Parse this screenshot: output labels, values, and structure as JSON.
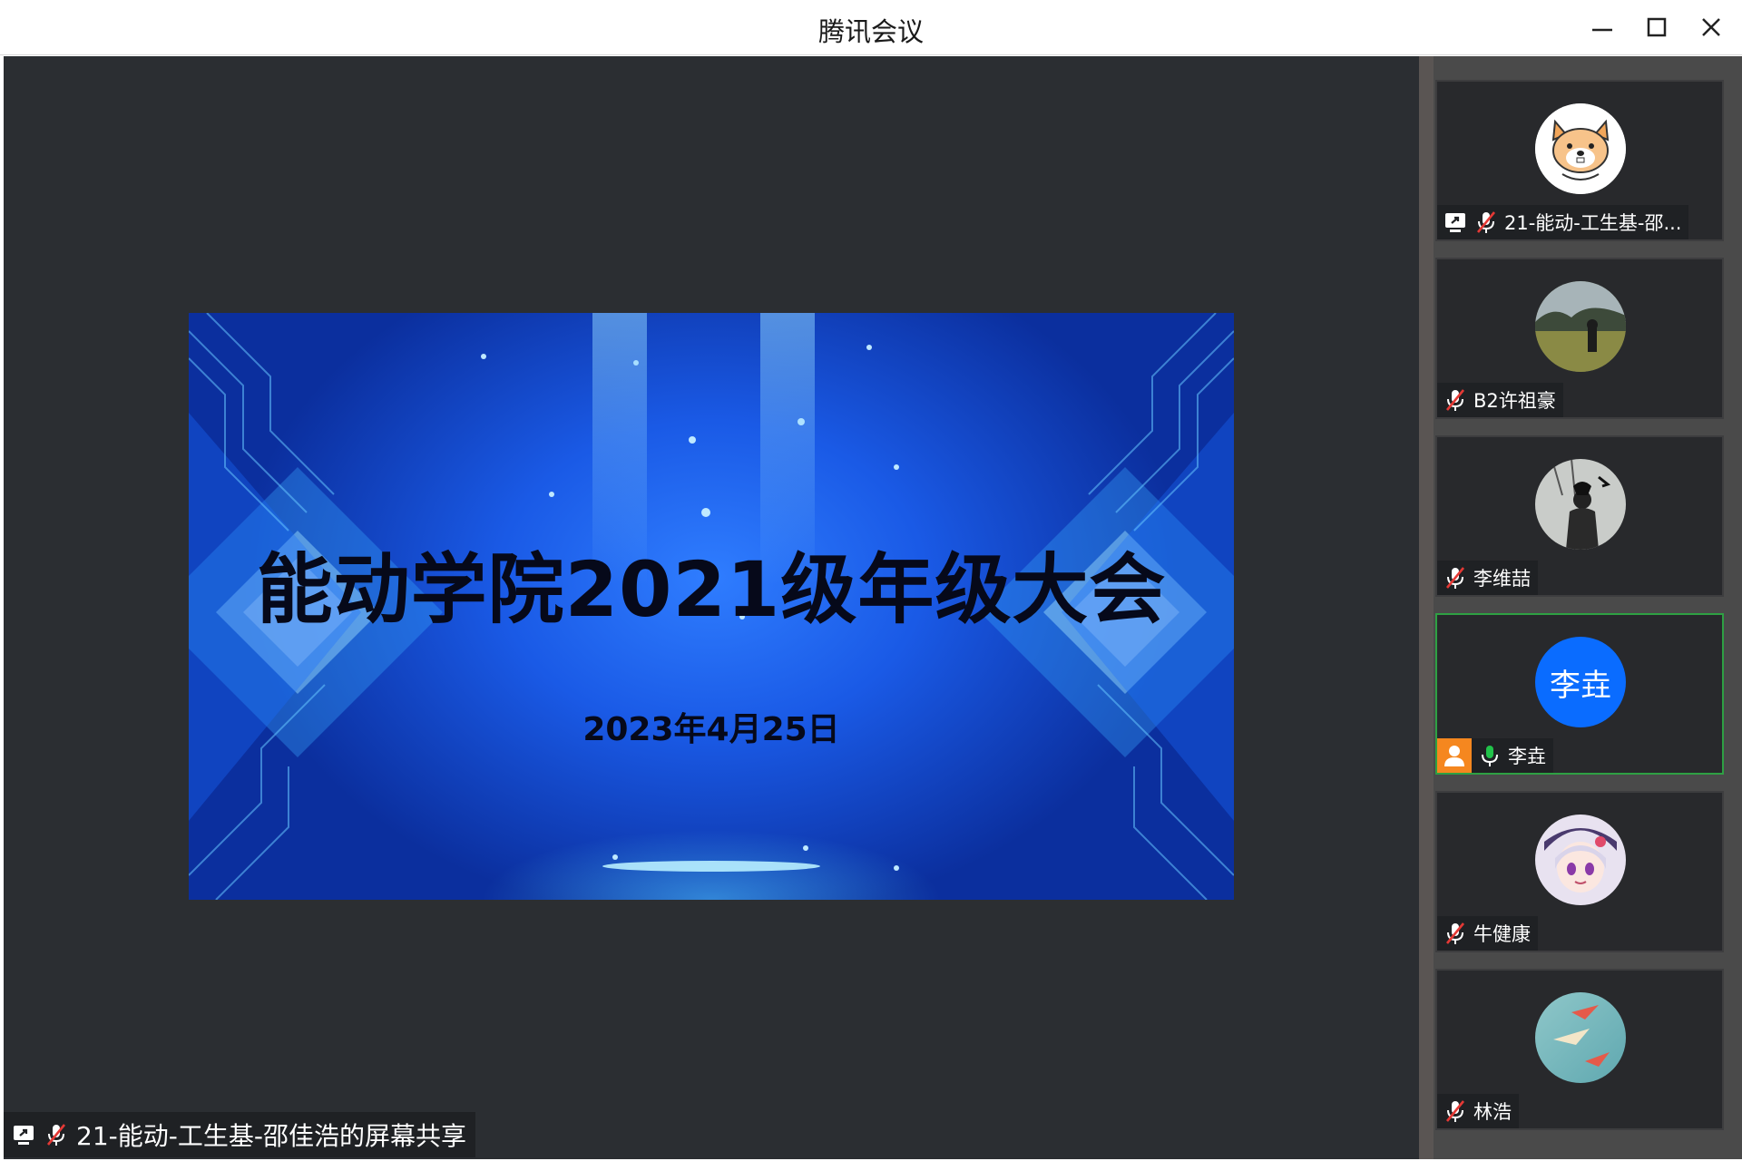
{
  "window": {
    "title": "腾讯会议",
    "minimize_icon": "minimize-icon",
    "maximize_icon": "maximize-icon",
    "close_icon": "close-icon"
  },
  "slide": {
    "title": "能动学院2021级年级大会",
    "date": "2023年4月25日"
  },
  "share_label": {
    "text": "21-能动-工生基-邵佳浩的屏幕共享",
    "icons": [
      "screen-share-icon",
      "mic-muted-icon"
    ]
  },
  "participants": [
    {
      "name": "21-能动-工生基-邵...",
      "avatar": "dog-cartoon",
      "sharing": true,
      "mic": "muted",
      "active": false
    },
    {
      "name": "B2许祖豪",
      "avatar": "landscape-photo",
      "sharing": false,
      "mic": "muted",
      "active": false
    },
    {
      "name": "李维喆",
      "avatar": "sketch-figure",
      "sharing": false,
      "mic": "muted",
      "active": false
    },
    {
      "name": "李垚",
      "avatar_text": "李垚",
      "avatar": "initials",
      "host": true,
      "sharing": false,
      "mic": "on",
      "active": true
    },
    {
      "name": "牛健康",
      "avatar": "anime-character",
      "sharing": false,
      "mic": "muted",
      "active": false
    },
    {
      "name": "林浩",
      "avatar": "paper-planes",
      "sharing": false,
      "mic": "muted",
      "active": false
    }
  ],
  "colors": {
    "stage_bg": "#2b2e32",
    "active_border": "#2ea043",
    "host_badge": "#f5871f",
    "initials_avatar": "#0a6cff",
    "mic_on": "#21c24a",
    "mic_muted": "#e53935"
  }
}
